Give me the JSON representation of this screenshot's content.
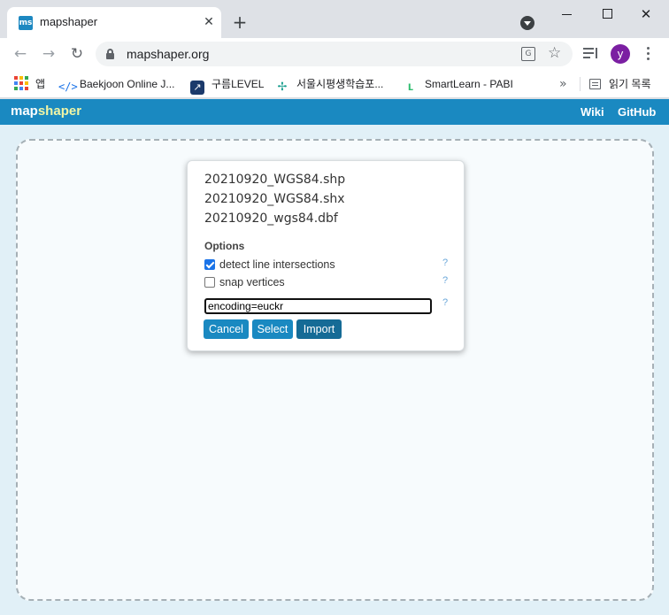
{
  "browser": {
    "tab": {
      "title": "mapshaper",
      "favicon_text": "ms"
    },
    "newtab_symbol": "+",
    "close_symbol": "✕",
    "window_close_symbol": "✕",
    "address": {
      "url": "mapshaper.org"
    },
    "profile_initial": "y",
    "nav": {
      "back": "←",
      "forward": "→",
      "reload": "↻"
    },
    "star_symbol": "☆",
    "translate_symbol": "G",
    "bookmarks": [
      {
        "label": "앱",
        "icon": "apps-grid-icon"
      },
      {
        "label": "Baekjoon Online J...",
        "icon": "code-icon"
      },
      {
        "label": "구름LEVEL",
        "icon": "arrow-up-right-icon"
      },
      {
        "label": "서울시평생학습포...",
        "icon": "seoul-logo-icon"
      },
      {
        "label": "SmartLearn - PABI",
        "icon": "smartlearn-icon"
      }
    ],
    "bookmarks_more": "»",
    "reading_list": "읽기 목록"
  },
  "app": {
    "logo_part1": "map",
    "logo_part2": "shaper",
    "links": {
      "wiki": "Wiki",
      "github": "GitHub"
    }
  },
  "dialog": {
    "files": [
      "20210920_WGS84.shp",
      "20210920_WGS84.shx",
      "20210920_wgs84.dbf"
    ],
    "options_heading": "Options",
    "options": [
      {
        "label": "detect line intersections",
        "checked": true
      },
      {
        "label": "snap vertices",
        "checked": false
      }
    ],
    "help_symbol": "?",
    "command_input": {
      "value": "encoding=euckr"
    },
    "buttons": {
      "cancel": "Cancel",
      "select": "Select",
      "import": "Import"
    }
  },
  "colors": {
    "header": "#1a89c1",
    "button": "#1a89c1",
    "button_active": "#156b96",
    "logo_accent": "#f1f5a5",
    "content_bg": "#e1f0f7",
    "avatar": "#7b1fa2"
  }
}
